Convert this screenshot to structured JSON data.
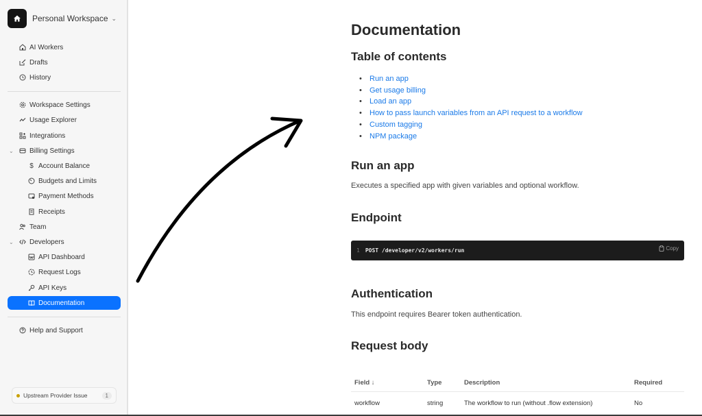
{
  "sidebar": {
    "workspace_name": "Personal Workspace",
    "items": [
      {
        "label": "AI Workers",
        "icon": "home-icon"
      },
      {
        "label": "Drafts",
        "icon": "edit-icon"
      },
      {
        "label": "History",
        "icon": "history-icon"
      },
      {
        "label": "Workspace Settings",
        "icon": "gear-icon"
      },
      {
        "label": "Usage Explorer",
        "icon": "trend-icon"
      },
      {
        "label": "Integrations",
        "icon": "integrations-icon"
      },
      {
        "label": "Billing Settings",
        "icon": "card-icon",
        "expanded": true
      },
      {
        "label": "Account Balance",
        "icon": "dollar-icon"
      },
      {
        "label": "Budgets and Limits",
        "icon": "gauge-icon"
      },
      {
        "label": "Payment Methods",
        "icon": "payment-icon"
      },
      {
        "label": "Receipts",
        "icon": "receipt-icon"
      },
      {
        "label": "Team",
        "icon": "team-icon"
      },
      {
        "label": "Developers",
        "icon": "code-icon",
        "expanded": true
      },
      {
        "label": "API Dashboard",
        "icon": "dashboard-icon"
      },
      {
        "label": "Request Logs",
        "icon": "clock-icon"
      },
      {
        "label": "API Keys",
        "icon": "key-icon"
      },
      {
        "label": "Documentation",
        "icon": "book-icon",
        "active": true
      },
      {
        "label": "Help and Support",
        "icon": "help-icon"
      }
    ],
    "status": {
      "label": "Upstream Provider Issue",
      "count": "1",
      "color": "#c9a000"
    }
  },
  "main": {
    "title": "Documentation",
    "toc_heading": "Table of contents",
    "toc": [
      "Run an app",
      "Get usage billing",
      "Load an app",
      "How to pass launch variables from an API request to a workflow",
      "Custom tagging",
      "NPM package"
    ],
    "run_heading": "Run an app",
    "run_desc": "Executes a specified app with given variables and optional workflow.",
    "endpoint_heading": "Endpoint",
    "code": {
      "line_number": "1",
      "text": "POST /developer/v2/workers/run",
      "copy_label": "Copy"
    },
    "auth_heading": "Authentication",
    "auth_desc": "This endpoint requires Bearer token authentication.",
    "request_heading": "Request body",
    "table": {
      "headers": [
        "Field ↓",
        "Type",
        "Description",
        "Required"
      ],
      "rows": [
        [
          "workflow",
          "string",
          "The workflow to run (without .flow extension)",
          "No"
        ]
      ]
    }
  },
  "colors": {
    "accent": "#0a72ff",
    "link": "#1a7ae8"
  }
}
